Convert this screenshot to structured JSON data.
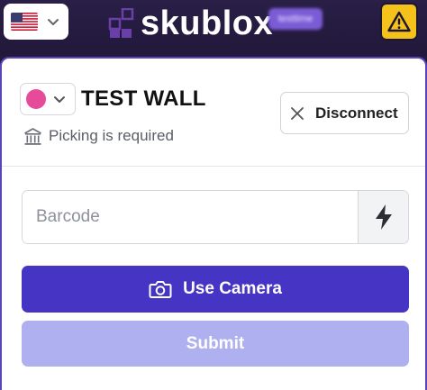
{
  "header": {
    "language": {
      "selected": "United States flag",
      "icon": "us-flag-icon"
    },
    "brand": {
      "name": "skublox",
      "icon": "skublox-logo-icon"
    },
    "environment_badge": "testtime",
    "warning": {
      "icon": "warning-icon"
    }
  },
  "station": {
    "color": "#e84a9a",
    "name": "TEST WALL",
    "status_text": "Picking is required",
    "status_icon": "warehouse-icon"
  },
  "actions": {
    "disconnect_label": "Disconnect",
    "disconnect_icon": "close-icon",
    "barcode_placeholder": "Barcode",
    "barcode_value": "",
    "flash_icon": "lightning-icon",
    "camera_label": "Use Camera",
    "camera_icon": "camera-icon",
    "submit_label": "Submit"
  },
  "colors": {
    "header_bg": "#241a3d",
    "card_border": "#5b44b8",
    "primary": "#4634c4",
    "submit_disabled": "#aeb0f0",
    "warning": "#f4c21a"
  }
}
